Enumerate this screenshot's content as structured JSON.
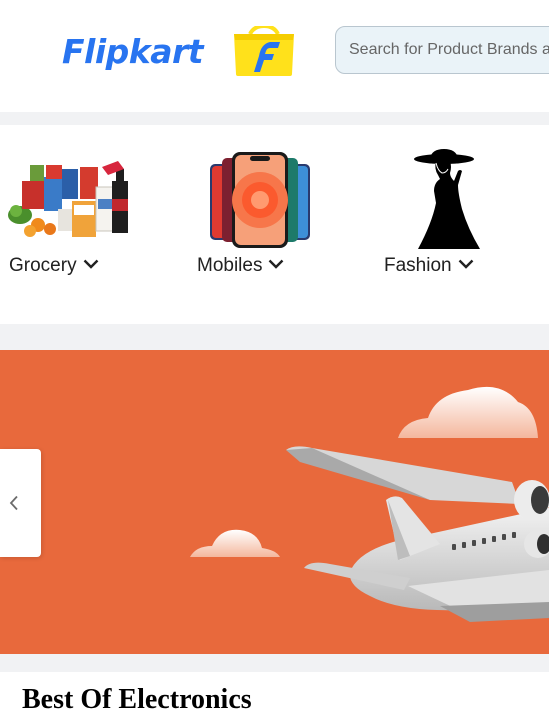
{
  "header": {
    "logo_text": "Flipkart",
    "search_placeholder": "Search for Product Brands and More"
  },
  "categories": [
    {
      "label": "Grocery",
      "icon": "grocery-basket"
    },
    {
      "label": "Mobiles",
      "icon": "smartphones"
    },
    {
      "label": "Fashion",
      "icon": "woman-in-hat-silhouette"
    }
  ],
  "banner": {
    "background_color": "#e8693c",
    "image": "airplane-with-clouds",
    "prev_icon": "chevron-left-icon"
  },
  "section": {
    "title": "Best Of Electronics"
  },
  "colors": {
    "brand_blue": "#2874f0",
    "brand_yellow": "#ffe11b",
    "page_background": "#f1f2f4"
  }
}
